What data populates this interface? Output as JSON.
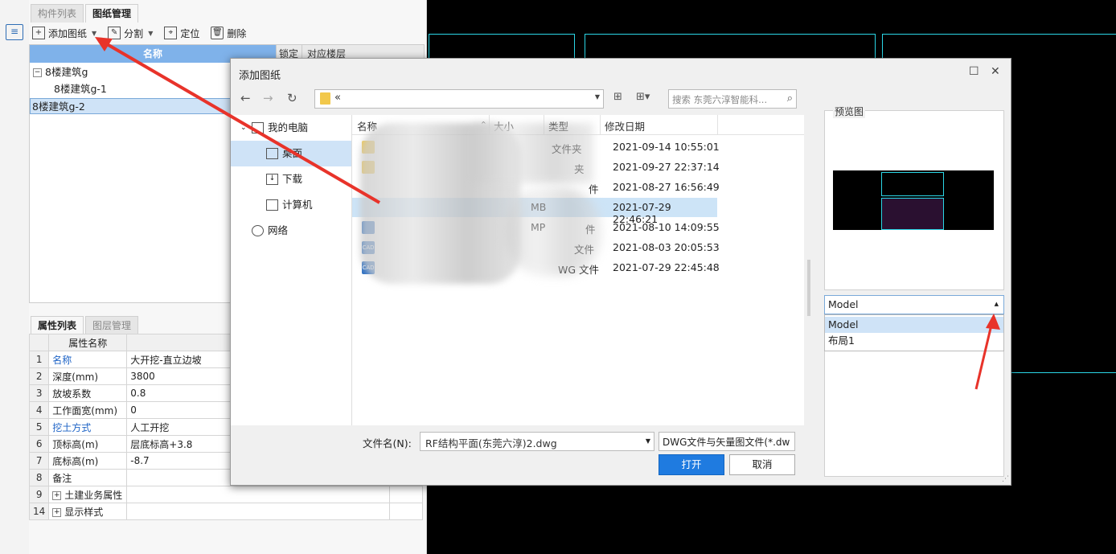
{
  "left_toolbar": {
    "icon": "list-icon"
  },
  "panel": {
    "tabs": [
      "构件列表",
      "图纸管理"
    ],
    "toolbar": {
      "add": "添加图纸",
      "split": "分割",
      "locate": "定位",
      "delete": "删除"
    },
    "tree": {
      "columns": [
        "名称",
        "锁定",
        "对应楼层"
      ],
      "rows": [
        {
          "label": "8楼建筑g",
          "expander": "−"
        },
        {
          "label": "8楼建筑g-1"
        },
        {
          "label": "8楼建筑g-2"
        }
      ]
    },
    "props_tabs": [
      "属性列表",
      "图层管理"
    ],
    "props": {
      "header": "属性名称",
      "rows": [
        {
          "idx": "1",
          "name": "名称",
          "value": "大开挖-直立边坡"
        },
        {
          "idx": "2",
          "name": "深度(mm)",
          "value": "3800"
        },
        {
          "idx": "3",
          "name": "放坡系数",
          "value": "0.8"
        },
        {
          "idx": "4",
          "name": "工作面宽(mm)",
          "value": "0"
        },
        {
          "idx": "5",
          "name": "挖土方式",
          "value": "人工开挖"
        },
        {
          "idx": "6",
          "name": "顶标高(m)",
          "value": "层底标高+3.8"
        },
        {
          "idx": "7",
          "name": "底标高(m)",
          "value": "-8.7"
        },
        {
          "idx": "8",
          "name": "备注",
          "value": ""
        },
        {
          "idx": "9",
          "name": "土建业务属性",
          "value": "",
          "expander": "+"
        },
        {
          "idx": "14",
          "name": "显示样式",
          "value": "",
          "expander": "+"
        }
      ]
    }
  },
  "dialog": {
    "title": "添加图纸",
    "path_text": "«",
    "search_placeholder": "搜索 东莞六淳智能科...",
    "nav": [
      {
        "label": "我的电脑"
      },
      {
        "label": "桌面"
      },
      {
        "label": "下载"
      },
      {
        "label": "计算机"
      },
      {
        "label": "网络"
      }
    ],
    "columns": [
      "名称",
      "大小",
      "类型",
      "修改日期"
    ],
    "files": [
      {
        "type": "文件夹",
        "date": "2021-09-14 10:55:01"
      },
      {
        "type": "夹",
        "date": "2021-09-27 22:37:14"
      },
      {
        "type": "件",
        "date": "2021-08-27 16:56:49"
      },
      {
        "size": "MB",
        "type": "",
        "date": "2021-07-29 22:46:21"
      },
      {
        "size": "MP",
        "type": "件",
        "date": "2021-08-10 14:09:55"
      },
      {
        "type": "文件",
        "date": "2021-08-03 20:05:53"
      },
      {
        "type": "WG 文件",
        "date": "2021-07-29 22:45:48"
      }
    ],
    "cad_icon": "CAD",
    "filename_label": "文件名(N):",
    "filename_value": "RF结构平面(东莞六淳)2.dwg",
    "filetype_value": "DWG文件与矢量图文件(*.dw",
    "open_label": "打开",
    "cancel_label": "取消",
    "preview_label": "预览图",
    "layout_selected": "Model",
    "layout_options": [
      "Model",
      "布局1"
    ]
  },
  "colors": {
    "accent": "#1f7be0",
    "selection": "#cfe3f7",
    "cad_line": "#2bd6e6",
    "arrow": "#e8332a"
  }
}
